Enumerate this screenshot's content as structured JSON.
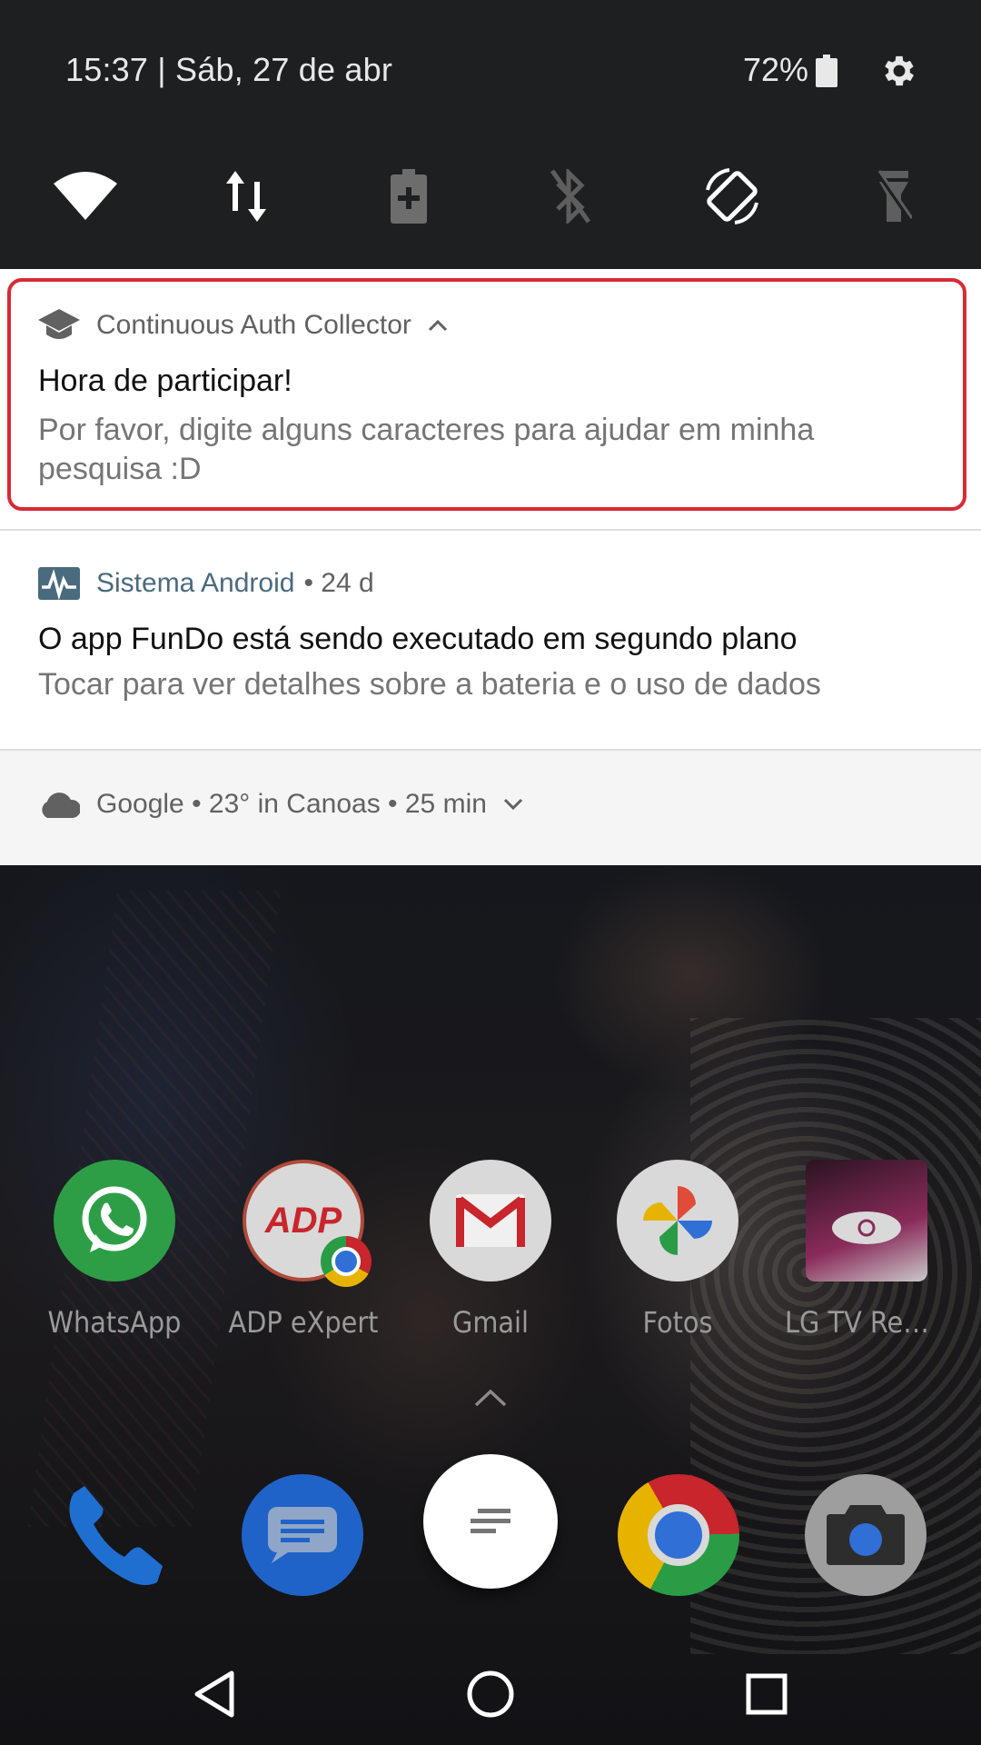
{
  "status_bar": {
    "datetime": "15:37 | Sáb, 27 de abr",
    "battery": "72%"
  },
  "quick_settings": {
    "tiles": [
      {
        "name": "wifi-icon",
        "active": true
      },
      {
        "name": "mobile-data-icon",
        "active": true
      },
      {
        "name": "battery-saver-icon",
        "active": false
      },
      {
        "name": "bluetooth-off-icon",
        "active": false
      },
      {
        "name": "auto-rotate-icon",
        "active": true
      },
      {
        "name": "flashlight-off-icon",
        "active": false
      }
    ]
  },
  "notifications": [
    {
      "app": "Continuous Auth Collector",
      "title": "Hora de participar!",
      "body": "Por favor, digite alguns caracteres para ajudar em minha pesquisa :D",
      "highlight_color": "#d62b35"
    },
    {
      "app": "Sistema Android",
      "time": "• 24 d",
      "title": "O app FunDo está sendo executado em segundo plano",
      "body": "Tocar para ver detalhes sobre a bateria e o uso de dados",
      "accent": "#4a6a7d"
    },
    {
      "summary": "Google • 23° in Canoas • 25 min"
    }
  ],
  "home": {
    "apps": [
      {
        "label": "WhatsApp",
        "color": "#2e9e46"
      },
      {
        "label": "ADP eXpert",
        "color": "#d9d9d9"
      },
      {
        "label": "Gmail",
        "color": "#d9d9d9"
      },
      {
        "label": "Fotos",
        "color": "#d9d9d9"
      },
      {
        "label": "LG TV Rem...",
        "color": "#8a2b5a"
      }
    ],
    "dock": [
      {
        "name": "phone-icon",
        "color": "#1f6fd1"
      },
      {
        "name": "messages-icon",
        "color": "#1f63c9"
      },
      {
        "name": "chrome-icon",
        "color": "#c7c7c7"
      },
      {
        "name": "camera-icon",
        "color": "#9e9e9e"
      }
    ]
  }
}
